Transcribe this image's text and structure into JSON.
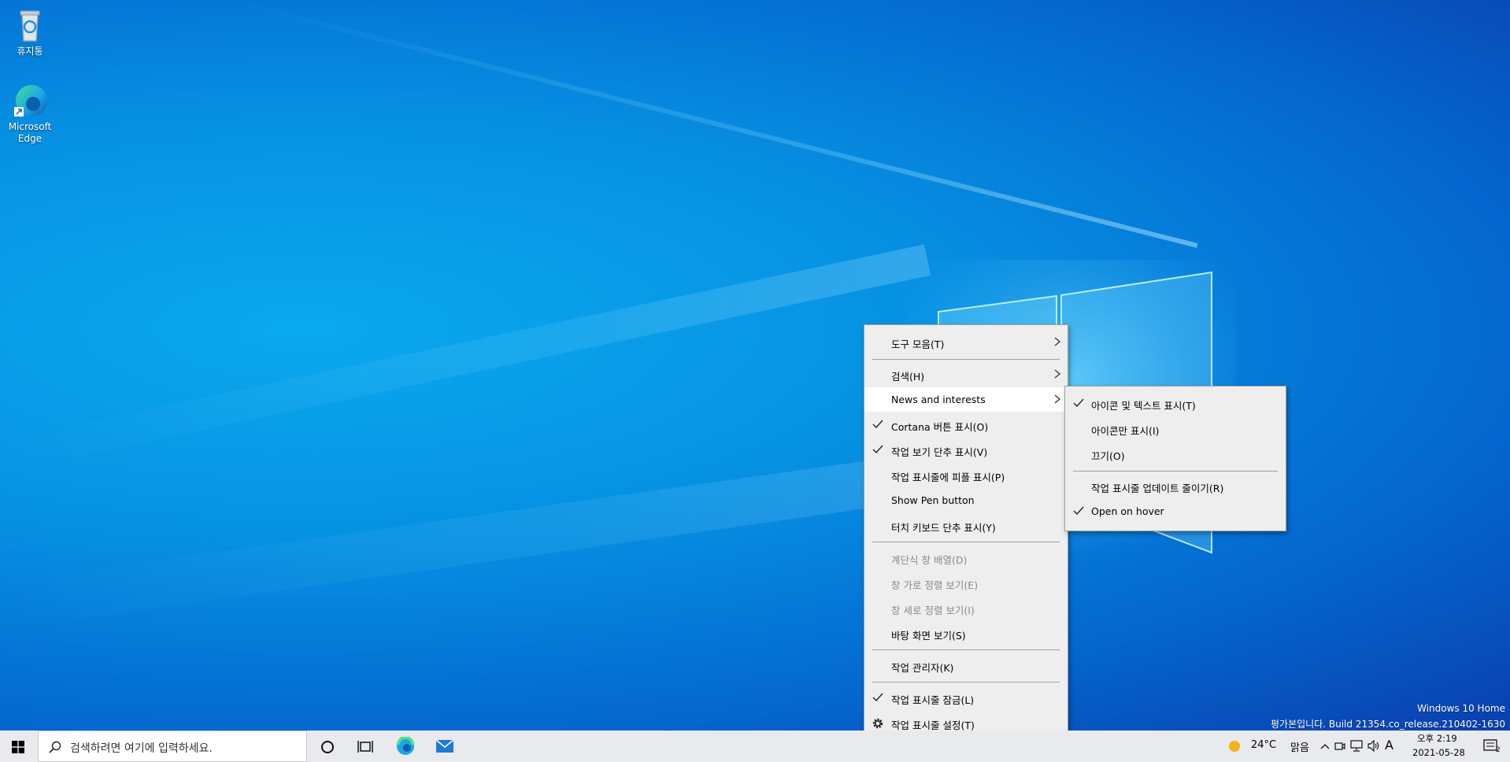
{
  "desktop": {
    "icons": [
      {
        "label": "휴지통",
        "icon": "recycle-bin-icon"
      },
      {
        "label": "Microsoft Edge",
        "label_line1": "Microsoft",
        "label_line2": "Edge",
        "icon": "edge-icon"
      }
    ],
    "watermark": {
      "edition": "Windows 10 Home",
      "build": "평가본입니다. Build 21354.co_release.210402-1630"
    }
  },
  "context_menu": {
    "items": [
      {
        "label": "도구 모음(T)",
        "submenu": true
      },
      {
        "label": "검색(H)",
        "submenu": true
      },
      {
        "label": "News and interests",
        "submenu": true,
        "highlighted": true
      },
      {
        "label": "Cortana 버튼 표시(O)",
        "checked": true
      },
      {
        "label": "작업 보기 단추 표시(V)",
        "checked": true
      },
      {
        "label": "작업 표시줄에 피플 표시(P)"
      },
      {
        "label": "Show Pen button"
      },
      {
        "label": "터치 키보드 단추 표시(Y)"
      },
      {
        "label": "계단식 창 배열(D)",
        "disabled": true
      },
      {
        "label": "창 가로 정렬 보기(E)",
        "disabled": true
      },
      {
        "label": "창 세로 정렬 보기(I)",
        "disabled": true
      },
      {
        "label": "바탕 화면 보기(S)"
      },
      {
        "label": "작업 관리자(K)"
      },
      {
        "label": "작업 표시줄 잠금(L)",
        "checked": true
      },
      {
        "label": "작업 표시줄 설정(T)",
        "icon": "gear-icon"
      }
    ]
  },
  "news_submenu": {
    "items": [
      {
        "label": "아이콘 및 텍스트 표시(T)",
        "checked": true
      },
      {
        "label": "아이콘만 표시(I)"
      },
      {
        "label": "끄기(O)"
      },
      {
        "label": "작업 표시줄 업데이트 줄이기(R)"
      },
      {
        "label": "Open on hover",
        "checked": true
      }
    ]
  },
  "taskbar": {
    "search_placeholder": "검색하려면 여기에 입력하세요.",
    "weather_temp": "24°C",
    "weather_desc": "맑음",
    "ime": "A",
    "time": "오후 2:19",
    "date": "2021-05-28",
    "notification_count": "2",
    "pinned": [
      "cortana-icon",
      "task-view-icon",
      "edge-icon",
      "mail-icon"
    ]
  },
  "colors": {
    "accent": "#0078d7",
    "taskbar": "#e8eaed",
    "menu": "#eeeeee"
  }
}
